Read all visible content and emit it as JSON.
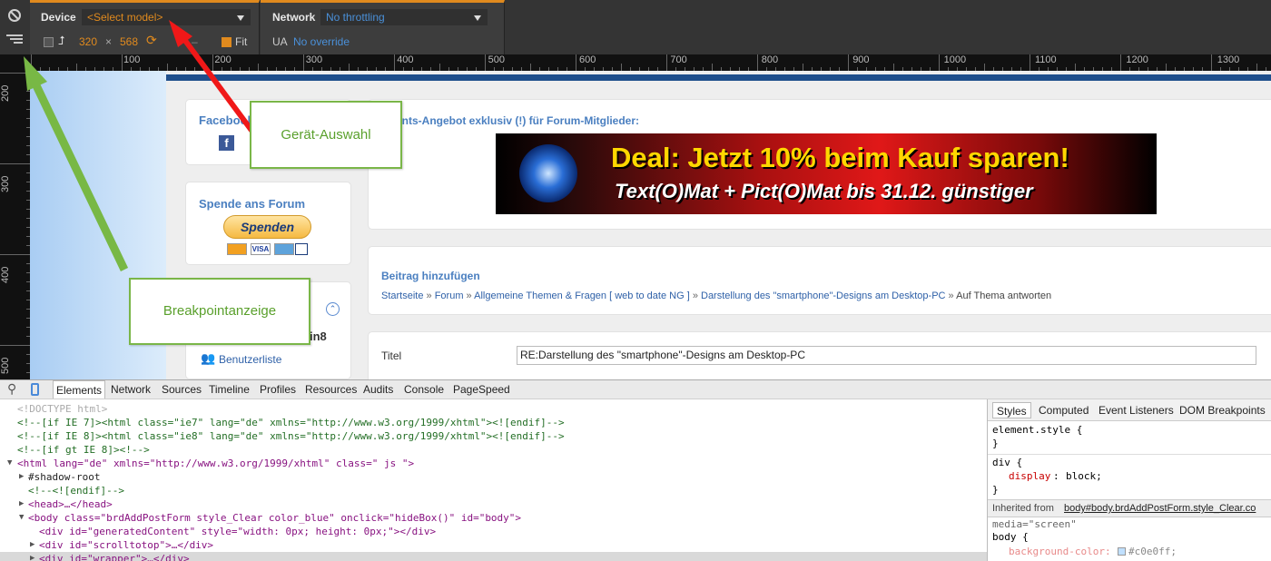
{
  "toolbar": {
    "device_label": "Device",
    "device_value": "<Select model>",
    "network_label": "Network",
    "network_value": "No throttling",
    "width": "320",
    "times": "×",
    "height": "568",
    "fit_label": "Fit",
    "minus": "–",
    "ua_label": "UA",
    "ua_value": "No override",
    "icons": [
      "ban-icon",
      "breakpoints-icon",
      "rotate-icon",
      "swap-icon"
    ]
  },
  "ruler": {
    "h_labels": [
      "100",
      "200",
      "300",
      "400",
      "500",
      "600",
      "700",
      "800",
      "900",
      "1000",
      "1100",
      "1200",
      "1300"
    ],
    "v_labels": [
      "200",
      "300",
      "400",
      "500"
    ]
  },
  "page": {
    "fb_title": "Facebook",
    "donate_title": "Spende ans Forum",
    "donate_button": "Spenden",
    "forum_tail": "in8",
    "userlist": "Benutzerliste",
    "offer_text": "ents-Angebot exklusiv (!) für Forum-Mitglieder:",
    "banner_line1": "Deal: Jetzt 10% beim Kauf sparen!",
    "banner_line2": "Text(O)Mat + Pict(O)Mat bis 31.12. günstiger",
    "post_title": "Beitrag hinzufügen",
    "breadcrumb": [
      "Startseite",
      "Forum",
      "Allgemeine Themen & Fragen [ web to date NG ]",
      "Darstellung des \"smartphone\"-Designs am Desktop-PC",
      "Auf Thema antworten"
    ],
    "crumb_sep": "»",
    "field_label": "Titel",
    "field_value": "RE:Darstellung des \"smartphone\"-Designs am Desktop-PC"
  },
  "callouts": {
    "device": "Gerät-Auswahl",
    "breakpoints": "Breakpointanzeige"
  },
  "devtools": {
    "tabs": [
      "Elements",
      "Network",
      "Sources",
      "Timeline",
      "Profiles",
      "Resources",
      "Audits",
      "Console",
      "PageSpeed"
    ],
    "code_lines": [
      "<!DOCTYPE html>",
      "<!--[if IE 7]><html class=\"ie7\" lang=\"de\" xmlns=\"http://www.w3.org/1999/xhtml\"><![endif]-->",
      "<!--[if IE 8]><html class=\"ie8\" lang=\"de\" xmlns=\"http://www.w3.org/1999/xhtml\"><![endif]-->",
      "<!--[if gt IE 8]><!-->",
      "<html lang=\"de\" xmlns=\"http://www.w3.org/1999/xhtml\" class=\" js \">",
      "#shadow-root",
      "<!--<![endif]-->",
      "<head>…</head>",
      "<body class=\"brdAddPostForm style_Clear color_blue\" onclick=\"hideBox()\" id=\"body\">",
      "<div id=\"generatedContent\" style=\"width: 0px; height: 0px;\"></div>",
      "<div id=\"scrolltotop\">…</div>",
      "<div id=\"wrapper\">…</div>"
    ],
    "style_tabs": [
      "Styles",
      "Computed",
      "Event Listeners",
      "DOM Breakpoints"
    ],
    "styles": {
      "r1_sel": "element.style {",
      "close": "}",
      "r2_sel": "div {",
      "r2_prop": "display",
      "r2_val": "block;",
      "inherited": "Inherited from",
      "inherited_link": "body#body.brdAddPostForm.style_Clear.co",
      "media": "media=\"screen\"",
      "r3_sel": "body {",
      "r3_prop": "background-color:",
      "r3_val": "#c0e0ff;"
    },
    "colors": {
      "swatch": "#c0e0ff",
      "accent": "#e08a1e",
      "link": "#4a90d9"
    }
  }
}
